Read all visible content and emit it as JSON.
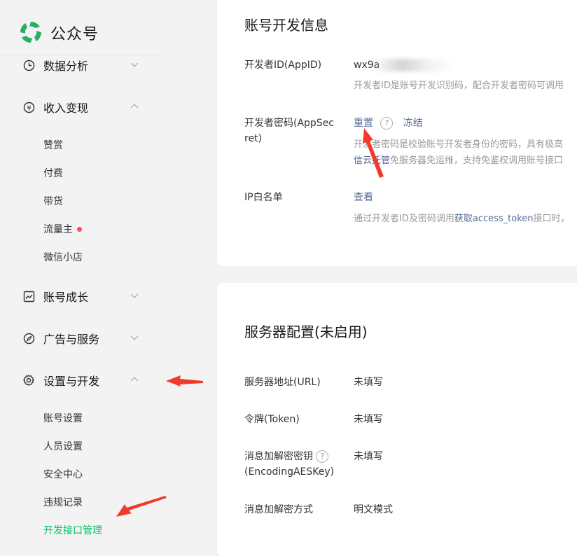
{
  "app": {
    "title": "公众号"
  },
  "sidebar": {
    "menu": [
      {
        "label": "数据分析",
        "icon": "clock-icon",
        "expanded": false
      },
      {
        "label": "收入变现",
        "icon": "yen-circle-icon",
        "expanded": true,
        "items": [
          {
            "label": "赞赏"
          },
          {
            "label": "付费"
          },
          {
            "label": "带货"
          },
          {
            "label": "流量主",
            "badge": "red-dot"
          },
          {
            "label": "微信小店"
          }
        ]
      },
      {
        "label": "账号成长",
        "icon": "trend-chart-icon",
        "expanded": false
      },
      {
        "label": "广告与服务",
        "icon": "compass-icon",
        "expanded": false
      },
      {
        "label": "设置与开发",
        "icon": "gear-icon",
        "expanded": true,
        "items": [
          {
            "label": "账号设置"
          },
          {
            "label": "人员设置"
          },
          {
            "label": "安全中心"
          },
          {
            "label": "违规记录"
          },
          {
            "label": "开发接口管理",
            "active": true
          }
        ]
      }
    ]
  },
  "dev_info": {
    "title": "账号开发信息",
    "appid": {
      "label": "开发者ID(AppID)",
      "value": "wx9a",
      "value_tail": "1",
      "desc": "开发者ID是账号开发识别码，配合开发者密码可调用"
    },
    "appsecret": {
      "label_line1": "开发者密码(AppSec",
      "label_line2": "ret)",
      "reset": "重置",
      "help": "?",
      "freeze": "冻结",
      "desc_line1": "开发者密码是校验账号开发者身份的密码，具有极高",
      "desc_line2_part1": "信云托管",
      "desc_line2_part2": "免服务器免运维，支持免鉴权调用账号接口"
    },
    "ip_whitelist": {
      "label": "IP白名单",
      "view": "查看",
      "desc_part1": "通过开发者ID及密码调用",
      "desc_link": "获取access_token",
      "desc_part2": "接口时，"
    }
  },
  "server_config": {
    "title": "服务器配置(未启用)",
    "rows": [
      {
        "label": "服务器地址(URL)",
        "value": "未填写"
      },
      {
        "label": "令牌(Token)",
        "value": "未填写"
      },
      {
        "label_line1": "消息加解密密钥",
        "label_line2": "(EncodingAESKey)",
        "value": "未填写"
      },
      {
        "label": "消息加解密方式",
        "value": "明文模式"
      }
    ],
    "help": "?"
  },
  "colors": {
    "accent": "#07c160",
    "link": "#576b95",
    "arrow": "#f23a2a",
    "badge": "#fa5151"
  }
}
